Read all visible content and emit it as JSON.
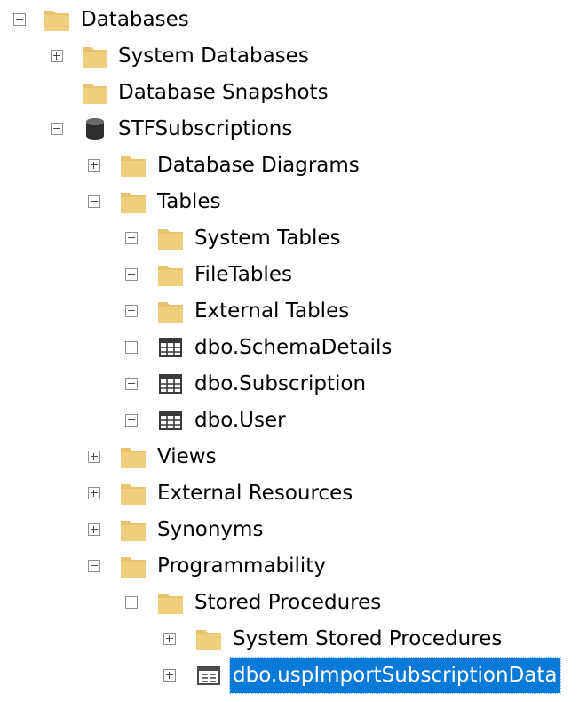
{
  "colors": {
    "folder": "#e8c26d",
    "database": "#3a3a3a",
    "selection": "#0a7ad8",
    "selected_text": "#ffffff"
  },
  "tree": {
    "databases": {
      "label": "Databases",
      "icon": "folder-icon",
      "expanded": true
    },
    "system_databases": {
      "label": "System Databases",
      "icon": "folder-icon",
      "expanded": false
    },
    "database_snapshots": {
      "label": "Database Snapshots",
      "icon": "folder-icon"
    },
    "stfsubscriptions": {
      "label": "STFSubscriptions",
      "icon": "database-icon",
      "expanded": true
    },
    "database_diagrams": {
      "label": "Database Diagrams",
      "icon": "folder-icon",
      "expanded": false
    },
    "tables": {
      "label": "Tables",
      "icon": "folder-icon",
      "expanded": true
    },
    "system_tables": {
      "label": "System Tables",
      "icon": "folder-icon",
      "expanded": false
    },
    "filetables": {
      "label": "FileTables",
      "icon": "folder-icon",
      "expanded": false
    },
    "external_tables": {
      "label": "External Tables",
      "icon": "folder-icon",
      "expanded": false
    },
    "schema_details": {
      "label": "dbo.SchemaDetails",
      "icon": "table-icon",
      "expanded": false
    },
    "subscription": {
      "label": "dbo.Subscription",
      "icon": "table-icon",
      "expanded": false
    },
    "user": {
      "label": "dbo.User",
      "icon": "table-icon",
      "expanded": false
    },
    "views": {
      "label": "Views",
      "icon": "folder-icon",
      "expanded": false
    },
    "external_resources": {
      "label": "External Resources",
      "icon": "folder-icon",
      "expanded": false
    },
    "synonyms": {
      "label": "Synonyms",
      "icon": "folder-icon",
      "expanded": false
    },
    "programmability": {
      "label": "Programmability",
      "icon": "folder-icon",
      "expanded": true
    },
    "stored_procedures": {
      "label": "Stored Procedures",
      "icon": "folder-icon",
      "expanded": true
    },
    "system_stored_procedures": {
      "label": "System Stored Procedures",
      "icon": "folder-icon",
      "expanded": false
    },
    "usp_import": {
      "label": "dbo.uspImportSubscriptionData",
      "icon": "stored-procedure-icon",
      "expanded": false,
      "selected": true
    }
  }
}
